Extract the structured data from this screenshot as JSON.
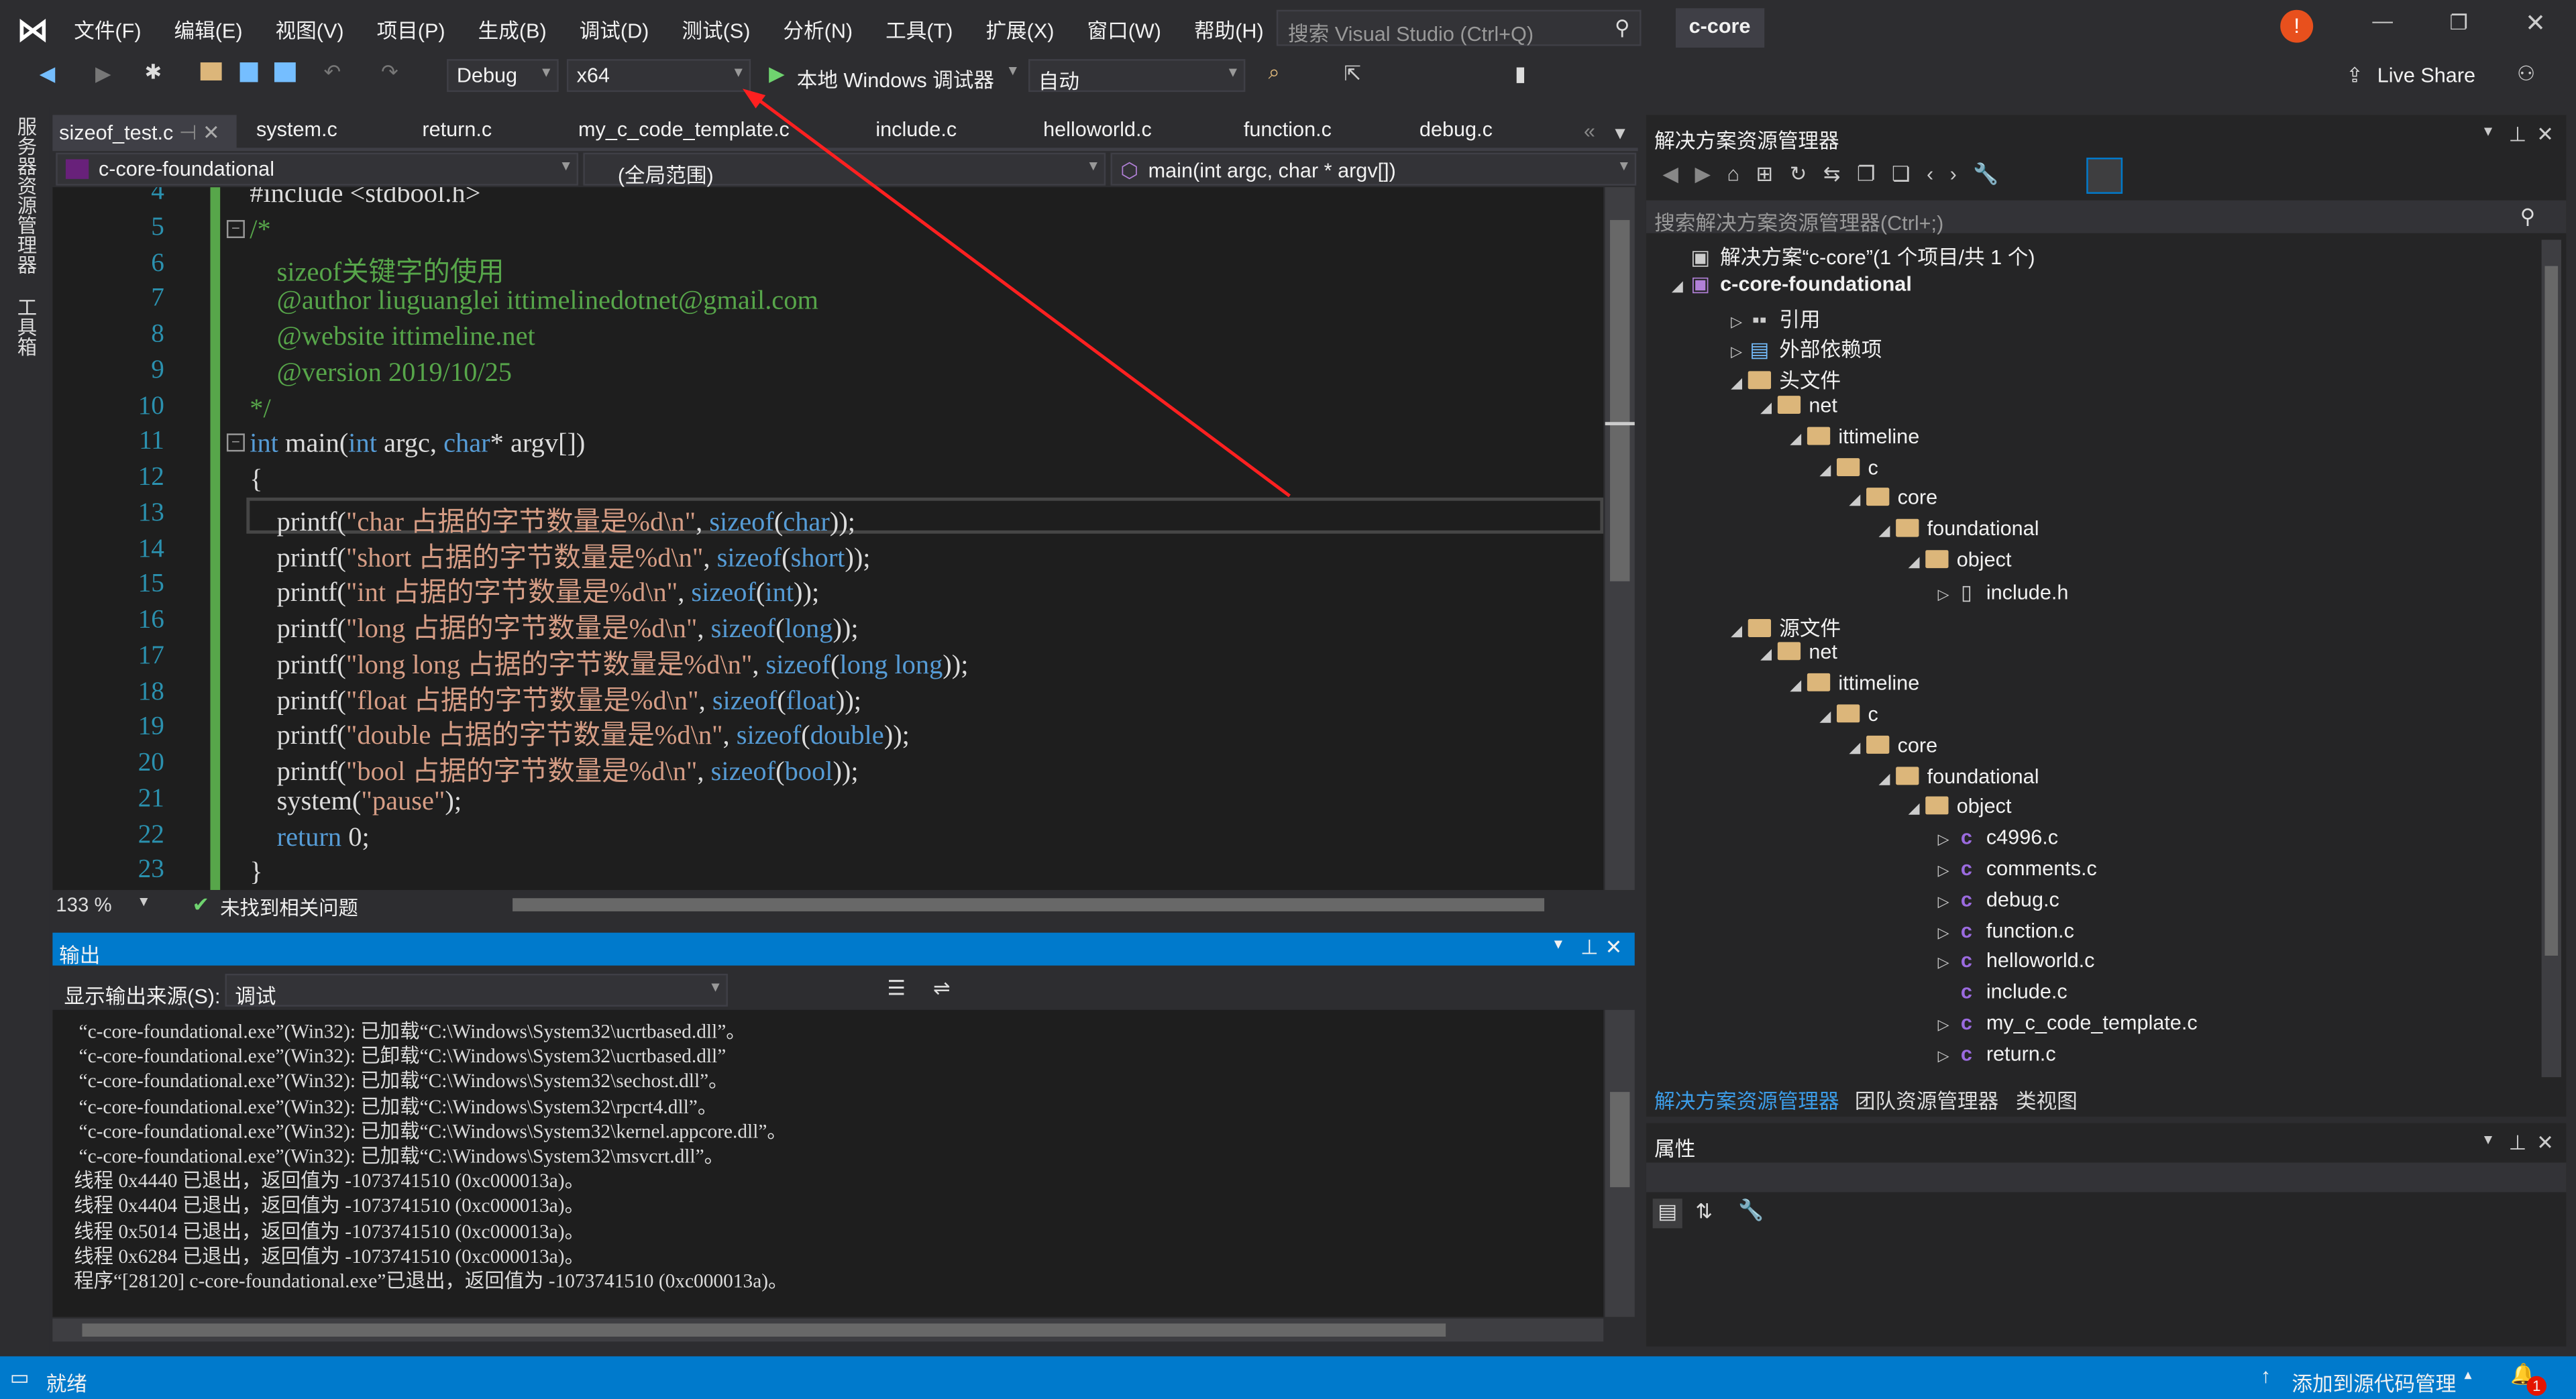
{
  "menu": [
    "文件(F)",
    "编辑(E)",
    "视图(V)",
    "项目(P)",
    "生成(B)",
    "调试(D)",
    "测试(S)",
    "分析(N)",
    "工具(T)",
    "扩展(X)",
    "窗口(W)",
    "帮助(H)"
  ],
  "search_placeholder": "搜索 Visual Studio (Ctrl+Q)",
  "solution_name": "c-core",
  "window_controls": [
    "minimize",
    "restore",
    "close"
  ],
  "toolbar": {
    "config": "Debug",
    "platform": "x64",
    "run": "本地 Windows 调试器",
    "run_mode": "自动",
    "live_share": "Live Share"
  },
  "left_strip": [
    "服务器资源管理器",
    "工具箱"
  ],
  "tabs": [
    {
      "label": "sizeof_test.c",
      "active": true
    },
    {
      "label": "system.c"
    },
    {
      "label": "return.c"
    },
    {
      "label": "my_c_code_template.c"
    },
    {
      "label": "include.c"
    },
    {
      "label": "helloworld.c"
    },
    {
      "label": "function.c"
    },
    {
      "label": "debug.c"
    }
  ],
  "nav": {
    "project": "c-core-foundational",
    "scope": "(全局范围)",
    "member": "main(int argc, char * argv[])"
  },
  "code": [
    {
      "n": "4",
      "tokens": [
        {
          "t": "#include <stdbool.h>",
          "c": "plain"
        }
      ]
    },
    {
      "n": "5",
      "tokens": [
        {
          "t": "/*",
          "c": "comment"
        }
      ]
    },
    {
      "n": "6",
      "tokens": [
        {
          "t": "    sizeof关键字的使用",
          "c": "comment"
        }
      ]
    },
    {
      "n": "7",
      "tokens": [
        {
          "t": "    @author liuguanglei ittimelinedotnet@gmail.com",
          "c": "comment"
        }
      ]
    },
    {
      "n": "8",
      "tokens": [
        {
          "t": "    @website ittimeline.net",
          "c": "comment"
        }
      ]
    },
    {
      "n": "9",
      "tokens": [
        {
          "t": "    @version 2019/10/25",
          "c": "comment"
        }
      ]
    },
    {
      "n": "10",
      "tokens": [
        {
          "t": "*/",
          "c": "comment"
        }
      ]
    },
    {
      "n": "11",
      "tokens": [
        {
          "t": "int",
          "c": "keyword"
        },
        {
          "t": " main(",
          "c": "plain"
        },
        {
          "t": "int",
          "c": "keyword"
        },
        {
          "t": " argc, ",
          "c": "plain"
        },
        {
          "t": "char",
          "c": "keyword"
        },
        {
          "t": "* argv[])",
          "c": "plain"
        }
      ]
    },
    {
      "n": "12",
      "tokens": [
        {
          "t": "{",
          "c": "plain"
        }
      ]
    },
    {
      "n": "13",
      "tokens": [
        {
          "t": "    printf(",
          "c": "plain"
        },
        {
          "t": "\"char 占据的字节数量是%d\\n\"",
          "c": "string"
        },
        {
          "t": ", ",
          "c": "plain"
        },
        {
          "t": "sizeof",
          "c": "keyword"
        },
        {
          "t": "(",
          "c": "plain"
        },
        {
          "t": "char",
          "c": "keyword"
        },
        {
          "t": "));",
          "c": "plain"
        }
      ]
    },
    {
      "n": "14",
      "tokens": [
        {
          "t": "    printf(",
          "c": "plain"
        },
        {
          "t": "\"short 占据的字节数量是%d\\n\"",
          "c": "string"
        },
        {
          "t": ", ",
          "c": "plain"
        },
        {
          "t": "sizeof",
          "c": "keyword"
        },
        {
          "t": "(",
          "c": "plain"
        },
        {
          "t": "short",
          "c": "keyword"
        },
        {
          "t": "));",
          "c": "plain"
        }
      ]
    },
    {
      "n": "15",
      "tokens": [
        {
          "t": "    printf(",
          "c": "plain"
        },
        {
          "t": "\"int 占据的字节数量是%d\\n\"",
          "c": "string"
        },
        {
          "t": ", ",
          "c": "plain"
        },
        {
          "t": "sizeof",
          "c": "keyword"
        },
        {
          "t": "(",
          "c": "plain"
        },
        {
          "t": "int",
          "c": "keyword"
        },
        {
          "t": "));",
          "c": "plain"
        }
      ]
    },
    {
      "n": "16",
      "tokens": [
        {
          "t": "    printf(",
          "c": "plain"
        },
        {
          "t": "\"long 占据的字节数量是%d\\n\"",
          "c": "string"
        },
        {
          "t": ", ",
          "c": "plain"
        },
        {
          "t": "sizeof",
          "c": "keyword"
        },
        {
          "t": "(",
          "c": "plain"
        },
        {
          "t": "long",
          "c": "keyword"
        },
        {
          "t": "));",
          "c": "plain"
        }
      ]
    },
    {
      "n": "17",
      "tokens": [
        {
          "t": "    printf(",
          "c": "plain"
        },
        {
          "t": "\"long long 占据的字节数量是%d\\n\"",
          "c": "string"
        },
        {
          "t": ", ",
          "c": "plain"
        },
        {
          "t": "sizeof",
          "c": "keyword"
        },
        {
          "t": "(",
          "c": "plain"
        },
        {
          "t": "long long",
          "c": "keyword"
        },
        {
          "t": "));",
          "c": "plain"
        }
      ]
    },
    {
      "n": "18",
      "tokens": [
        {
          "t": "    printf(",
          "c": "plain"
        },
        {
          "t": "\"float 占据的字节数量是%d\\n\"",
          "c": "string"
        },
        {
          "t": ", ",
          "c": "plain"
        },
        {
          "t": "sizeof",
          "c": "keyword"
        },
        {
          "t": "(",
          "c": "plain"
        },
        {
          "t": "float",
          "c": "keyword"
        },
        {
          "t": "));",
          "c": "plain"
        }
      ]
    },
    {
      "n": "19",
      "tokens": [
        {
          "t": "    printf(",
          "c": "plain"
        },
        {
          "t": "\"double 占据的字节数量是%d\\n\"",
          "c": "string"
        },
        {
          "t": ", ",
          "c": "plain"
        },
        {
          "t": "sizeof",
          "c": "keyword"
        },
        {
          "t": "(",
          "c": "plain"
        },
        {
          "t": "double",
          "c": "keyword"
        },
        {
          "t": "));",
          "c": "plain"
        }
      ]
    },
    {
      "n": "20",
      "tokens": [
        {
          "t": "    printf(",
          "c": "plain"
        },
        {
          "t": "\"bool 占据的字节数量是%d\\n\"",
          "c": "string"
        },
        {
          "t": ", ",
          "c": "plain"
        },
        {
          "t": "sizeof",
          "c": "keyword"
        },
        {
          "t": "(",
          "c": "plain"
        },
        {
          "t": "bool",
          "c": "keyword"
        },
        {
          "t": "));",
          "c": "plain"
        }
      ]
    },
    {
      "n": "21",
      "tokens": [
        {
          "t": "    system(",
          "c": "plain"
        },
        {
          "t": "\"pause\"",
          "c": "string"
        },
        {
          "t": ");",
          "c": "plain"
        }
      ]
    },
    {
      "n": "22",
      "tokens": [
        {
          "t": "    ",
          "c": "plain"
        },
        {
          "t": "return",
          "c": "keyword"
        },
        {
          "t": " 0;",
          "c": "plain"
        }
      ]
    },
    {
      "n": "23",
      "tokens": [
        {
          "t": "}",
          "c": "plain"
        }
      ]
    }
  ],
  "editor_status": {
    "zoom": "133 %",
    "issues": "未找到相关问题"
  },
  "output": {
    "title": "输出",
    "source_label": "显示输出来源(S):",
    "source_value": "调试",
    "lines": [
      "“c-core-foundational.exe”(Win32): 已加载“C:\\Windows\\System32\\ucrtbased.dll”。",
      "“c-core-foundational.exe”(Win32): 已卸载“C:\\Windows\\System32\\ucrtbased.dll”",
      "“c-core-foundational.exe”(Win32): 已加载“C:\\Windows\\System32\\sechost.dll”。",
      "“c-core-foundational.exe”(Win32): 已加载“C:\\Windows\\System32\\rpcrt4.dll”。",
      "“c-core-foundational.exe”(Win32): 已加载“C:\\Windows\\System32\\kernel.appcore.dll”。",
      "“c-core-foundational.exe”(Win32): 已加载“C:\\Windows\\System32\\msvcrt.dll”。",
      "线程 0x4440 已退出，返回值为 -1073741510 (0xc000013a)。",
      "线程 0x4404 已退出，返回值为 -1073741510 (0xc000013a)。",
      "线程 0x5014 已退出，返回值为 -1073741510 (0xc000013a)。",
      "线程 0x6284 已退出，返回值为 -1073741510 (0xc000013a)。",
      "程序“[28120] c-core-foundational.exe”已退出，返回值为 -1073741510 (0xc000013a)。"
    ]
  },
  "solution_explorer": {
    "title": "解决方案资源管理器",
    "search_placeholder": "搜索解决方案资源管理器(Ctrl+;)",
    "tree": [
      {
        "label": "解决方案“c-core”(1 个项目/共 1 个)",
        "level": 0,
        "icon": "solution",
        "tw": ""
      },
      {
        "label": "c-core-foundational",
        "level": 0,
        "icon": "project",
        "tw": "◢",
        "bold": true
      },
      {
        "label": "引用",
        "level": 1,
        "icon": "references",
        "tw": "▷"
      },
      {
        "label": "外部依赖项",
        "level": 1,
        "icon": "external",
        "tw": "▷"
      },
      {
        "label": "头文件",
        "level": 1,
        "icon": "folder",
        "tw": "◢"
      },
      {
        "label": "net",
        "level": 2,
        "icon": "folder",
        "tw": "◢"
      },
      {
        "label": "ittimeline",
        "level": 3,
        "icon": "folder",
        "tw": "◢"
      },
      {
        "label": "c",
        "level": 4,
        "icon": "folder",
        "tw": "◢"
      },
      {
        "label": "core",
        "level": 5,
        "icon": "folder",
        "tw": "◢"
      },
      {
        "label": "foundational",
        "level": 6,
        "icon": "folder",
        "tw": "◢"
      },
      {
        "label": "object",
        "level": 7,
        "icon": "folder",
        "tw": "◢"
      },
      {
        "label": "include.h",
        "level": 8,
        "icon": "header",
        "tw": "▷"
      },
      {
        "label": "源文件",
        "level": 1,
        "icon": "folder",
        "tw": "◢"
      },
      {
        "label": "net",
        "level": 2,
        "icon": "folder",
        "tw": "◢"
      },
      {
        "label": "ittimeline",
        "level": 3,
        "icon": "folder",
        "tw": "◢"
      },
      {
        "label": "c",
        "level": 4,
        "icon": "folder",
        "tw": "◢"
      },
      {
        "label": "core",
        "level": 5,
        "icon": "folder",
        "tw": "◢"
      },
      {
        "label": "foundational",
        "level": 6,
        "icon": "folder",
        "tw": "◢"
      },
      {
        "label": "object",
        "level": 7,
        "icon": "folder",
        "tw": "◢"
      },
      {
        "label": "c4996.c",
        "level": 8,
        "icon": "c",
        "tw": "▷"
      },
      {
        "label": "comments.c",
        "level": 8,
        "icon": "c",
        "tw": "▷"
      },
      {
        "label": "debug.c",
        "level": 8,
        "icon": "c",
        "tw": "▷"
      },
      {
        "label": "function.c",
        "level": 8,
        "icon": "c",
        "tw": "▷"
      },
      {
        "label": "helloworld.c",
        "level": 8,
        "icon": "c",
        "tw": "▷"
      },
      {
        "label": "include.c",
        "level": 8,
        "icon": "c",
        "tw": ""
      },
      {
        "label": "my_c_code_template.c",
        "level": 8,
        "icon": "c",
        "tw": "▷"
      },
      {
        "label": "return.c",
        "level": 8,
        "icon": "c",
        "tw": "▷"
      }
    ],
    "bottom_tabs": [
      "解决方案资源管理器",
      "团队资源管理器",
      "类视图"
    ]
  },
  "properties": {
    "title": "属性"
  },
  "statusbar": {
    "ready": "就绪",
    "source_control": "添加到源代码管理",
    "notifications": "1"
  },
  "colors": {
    "accent": "#007acc",
    "background": "#2d2d30",
    "editor": "#1e1e1e",
    "annotation_arrow": "#ff2020"
  }
}
